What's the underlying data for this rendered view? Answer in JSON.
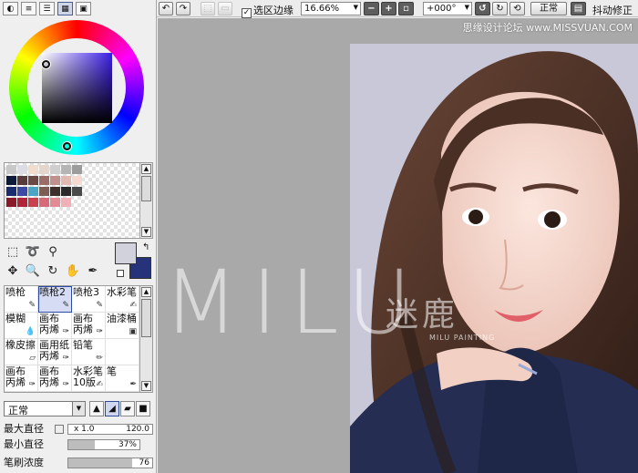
{
  "toolbar": {
    "undo_icon": "undo-icon",
    "redo_icon": "redo-icon",
    "selection_edge_label": "选区边缘",
    "selection_edge_checked": true,
    "zoom_value": "16.66%",
    "rotation_value": "+000°",
    "blend_label": "正常",
    "stabilizer_label": "抖动修正"
  },
  "site_watermark": "思缘设计论坛 www.MISSVUAN.COM",
  "panel_tabs": [
    "color-wheel-tab",
    "rgb-slider-tab",
    "hsv-slider-tab",
    "swatch-tab",
    "scratchpad-tab"
  ],
  "swatches": [
    [
      "#c8c8c8",
      "#dcdce4",
      "#f2dccb",
      "#e4d6cc",
      "#cfcfcf",
      "#b5b5b5",
      "#9c9c9c"
    ],
    [
      "#0e1a3a",
      "#5a3b3b",
      "#6b4a46",
      "#9a6e66",
      "#c0908c",
      "#e2b9b1",
      "#f6d9d0"
    ],
    [
      "#1b2c6e",
      "#3a4aa6",
      "#4aa6c4",
      "#7d5d54",
      "#3d2f2c",
      "#2a2a2a",
      "#4a4a4a"
    ],
    [
      "#8a1a2a",
      "#b02537",
      "#c8404e",
      "#d76a76",
      "#e38a94",
      "#f0b0b7"
    ]
  ],
  "colors": {
    "main": "#d2d2dc",
    "sub": "#26337a",
    "canvas_bg": "#a9a9a9",
    "selected_brush": "#d5dcf4"
  },
  "brushes": [
    {
      "label": "喷枪",
      "icon": "airbrush-icon"
    },
    {
      "label": "喷枪2",
      "icon": "airbrush-icon",
      "selected": true
    },
    {
      "label": "喷枪3",
      "icon": "airbrush-icon"
    },
    {
      "label": "水彩笔",
      "icon": "watercolor-icon"
    },
    {
      "label": "模糊",
      "icon": "blur-icon"
    },
    {
      "label": "画布 丙烯",
      "icon": "brush-icon"
    },
    {
      "label": "画布 丙烯",
      "icon": "brush-icon"
    },
    {
      "label": "油漆桶",
      "icon": "bucket-icon"
    },
    {
      "label": "橡皮擦",
      "icon": "eraser-icon"
    },
    {
      "label": "画用纸 丙烯",
      "icon": "brush-icon"
    },
    {
      "label": "铅笔",
      "icon": "pencil-icon"
    },
    {
      "label": "",
      "icon": ""
    },
    {
      "label": "画布 丙烯",
      "icon": "brush-icon"
    },
    {
      "label": "画布 丙烯",
      "icon": "brush-icon"
    },
    {
      "label": "水彩笔 10版",
      "icon": "watercolor-icon"
    },
    {
      "label": "笔",
      "icon": "pen-icon"
    }
  ],
  "brush_settings": {
    "blend_mode": "正常",
    "max_size_label": "最大直径",
    "size_multiplier": "x 1.0",
    "size_value": "120.0",
    "min_size_label": "最小直径",
    "min_size_value": "37%",
    "min_size_fraction": 0.37,
    "density_label": "笔刷浓度",
    "density_value": "76",
    "density_fraction": 0.76
  },
  "watermark": {
    "text": "MILU",
    "chinese": "迷鹿",
    "subtitle": "MILU PAINTING"
  }
}
